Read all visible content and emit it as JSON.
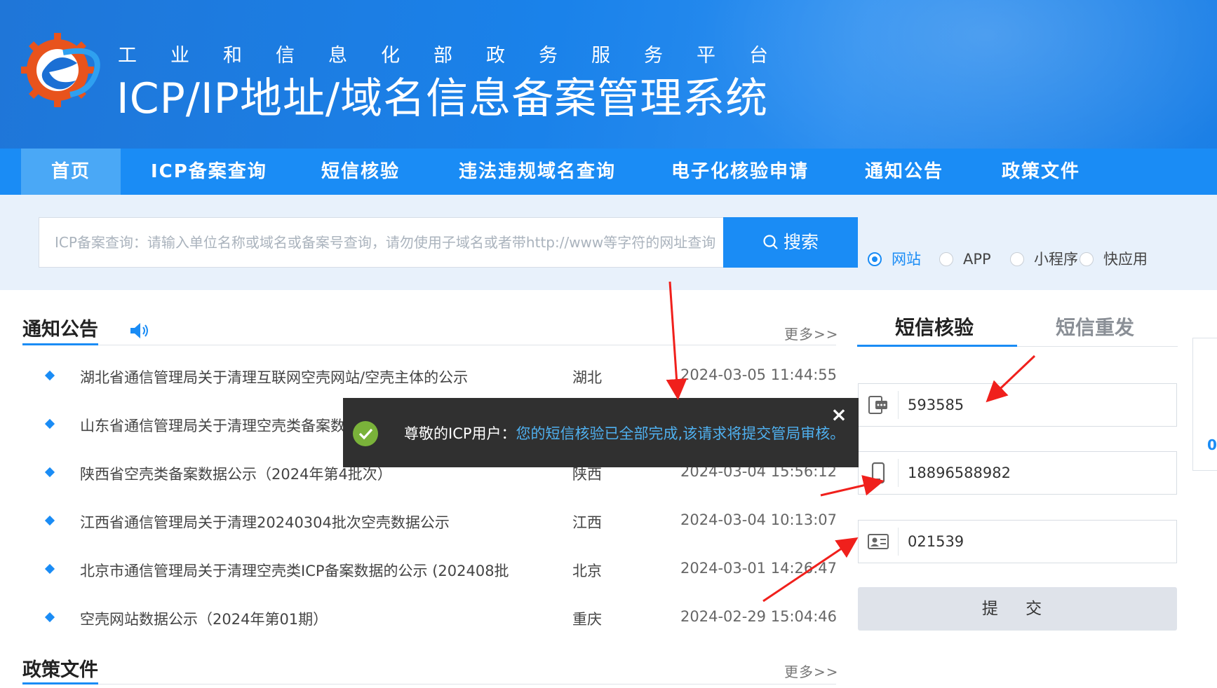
{
  "header": {
    "subtitle": "工业和信息化部政务服务平台",
    "title": "ICP/IP地址/域名信息备案管理系统"
  },
  "nav": {
    "items": [
      {
        "label": "首页",
        "active": true
      },
      {
        "label": "ICP备案查询"
      },
      {
        "label": "短信核验"
      },
      {
        "label": "违法违规域名查询"
      },
      {
        "label": "电子化核验申请"
      },
      {
        "label": "通知公告"
      },
      {
        "label": "政策文件"
      }
    ]
  },
  "search": {
    "placeholder": "ICP备案查询：请输入单位名称或域名或备案号查询，请勿使用子域名或者带http://www等字符的网址查询",
    "button_label": "搜索",
    "types": [
      {
        "label": "网站",
        "checked": true
      },
      {
        "label": "APP"
      },
      {
        "label": "小程序"
      },
      {
        "label": "快应用"
      }
    ]
  },
  "notices": {
    "title": "通知公告",
    "more": "更多>>",
    "items": [
      {
        "title": "湖北省通信管理局关于清理互联网空壳网站/空壳主体的公示",
        "province": "湖北",
        "time": "2024-03-05 11:44:55"
      },
      {
        "title": "山东省通信管理局关于清理空壳类备案数",
        "province": "",
        "time": ""
      },
      {
        "title": "陕西省空壳类备案数据公示（2024年第4批次）",
        "province": "陕西",
        "time": "2024-03-04 15:56:12"
      },
      {
        "title": "江西省通信管理局关于清理20240304批次空壳数据公示",
        "province": "江西",
        "time": "2024-03-04 10:13:07"
      },
      {
        "title": "北京市通信管理局关于清理空壳类ICP备案数据的公示 (202408批",
        "province": "北京",
        "time": "2024-03-01 14:26:47"
      },
      {
        "title": "空壳网站数据公示（2024年第01期）",
        "province": "重庆",
        "time": "2024-02-29 15:04:46"
      }
    ]
  },
  "policy": {
    "title": "政策文件",
    "more": "更多>>"
  },
  "sms": {
    "tabs": [
      {
        "label": "短信核验",
        "active": true
      },
      {
        "label": "短信重发"
      }
    ],
    "fields": {
      "verification_code": "593585",
      "phone": "18896588982",
      "id_suffix": "021539"
    },
    "submit_label": "提 交"
  },
  "toast": {
    "prefix": "尊敬的ICP用户：",
    "message": "您的短信核验已全部完成,该请求将提交管局审核。",
    "close": "×"
  },
  "side_panel": {
    "value": "0"
  },
  "colors": {
    "primary": "#1a8cf5",
    "header": "#1f7be0",
    "toast_bg": "#303030",
    "toast_highlight": "#4fb0ef",
    "success": "#7ab23a",
    "annotation": "#f0201c"
  }
}
